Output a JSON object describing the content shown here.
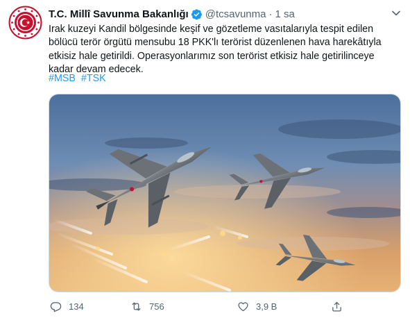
{
  "tweet": {
    "author_name": "T.C. Millî Savunma Bakanlığı",
    "handle": "@tcsavunma",
    "separator": "·",
    "time": "1 sa",
    "text_lines": [
      "Irak kuzeyi Kandil bölgesinde keşif ve gözetleme vasıtalarıyla tespit edilen",
      "bölücü terör örgütü mensubu 18 PKK'lı terörist düzenlenen hava harekâtıyla",
      "etkisiz hale getirildi. Operasyonlarımız son terörist etkisiz hale getirilinceye",
      "kadar devam edecek."
    ],
    "hashtags": [
      "#MSB",
      "#TSK"
    ]
  },
  "actions": {
    "reply_count": "134",
    "retweet_count": "756",
    "like_count": "3,9 B"
  },
  "colors": {
    "link": "#1d9bf0",
    "secondary_text": "#536471",
    "verified": "#1d9bf0",
    "avatar_red": "#c8102e"
  },
  "icons": {
    "verified": "verified-badge-icon",
    "menu": "chevron-down-icon",
    "reply": "reply-icon",
    "retweet": "retweet-icon",
    "like": "heart-icon",
    "share": "share-icon"
  }
}
